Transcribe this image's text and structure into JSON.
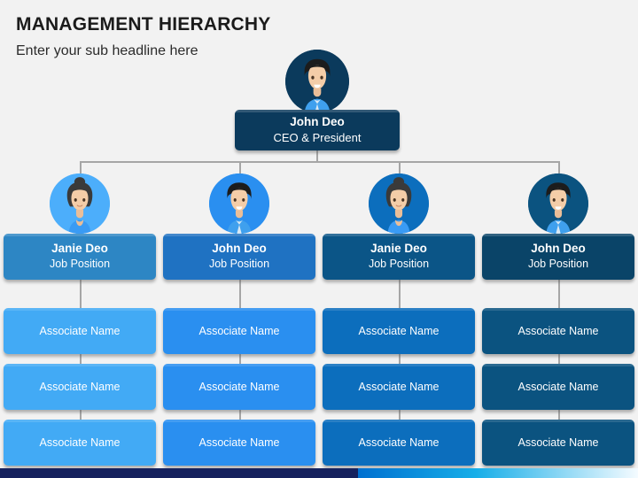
{
  "header": {
    "title": "MANAGEMENT HIERARCHY",
    "subtitle": "Enter your sub headline here"
  },
  "ceo": {
    "name": "John Deo",
    "position": "CEO & President",
    "avatar_icon": "male-avatar-icon",
    "box_color": "#0B3A5C",
    "avatar_bg": "#0B3A5C"
  },
  "managers": [
    {
      "name": "Janie Deo",
      "position": "Job Position",
      "avatar_icon": "female-avatar-icon",
      "box_color": "#2D86C4",
      "avatar_bg": "#4CAEFB",
      "associate_color": "#42AAF5",
      "associates": [
        "Associate Name",
        "Associate Name",
        "Associate Name"
      ]
    },
    {
      "name": "John Deo",
      "position": "Job Position",
      "avatar_icon": "male-avatar-icon",
      "box_color": "#1F72C2",
      "avatar_bg": "#2A8FF0",
      "associate_color": "#2A8FF0",
      "associates": [
        "Associate Name",
        "Associate Name",
        "Associate Name"
      ]
    },
    {
      "name": "Janie Deo",
      "position": "Job Position",
      "avatar_icon": "female-avatar-icon",
      "box_color": "#0B5587",
      "avatar_bg": "#0C6EBD",
      "associate_color": "#0C6EBD",
      "associates": [
        "Associate Name",
        "Associate Name",
        "Associate Name"
      ]
    },
    {
      "name": "John Deo",
      "position": "Job Position",
      "avatar_icon": "male-avatar-icon",
      "box_color": "#0A4468",
      "avatar_bg": "#0B5380",
      "associate_color": "#0B5380",
      "associates": [
        "Associate Name",
        "Associate Name",
        "Associate Name"
      ]
    }
  ],
  "footer": {
    "left_color": "#16225E",
    "gradient_start": "#0070D0",
    "gradient_mid": "#17AEE8",
    "gradient_end": "#F4FBFF"
  },
  "connector_color": "#a6a6a6",
  "background_color": "#f2f2f2"
}
